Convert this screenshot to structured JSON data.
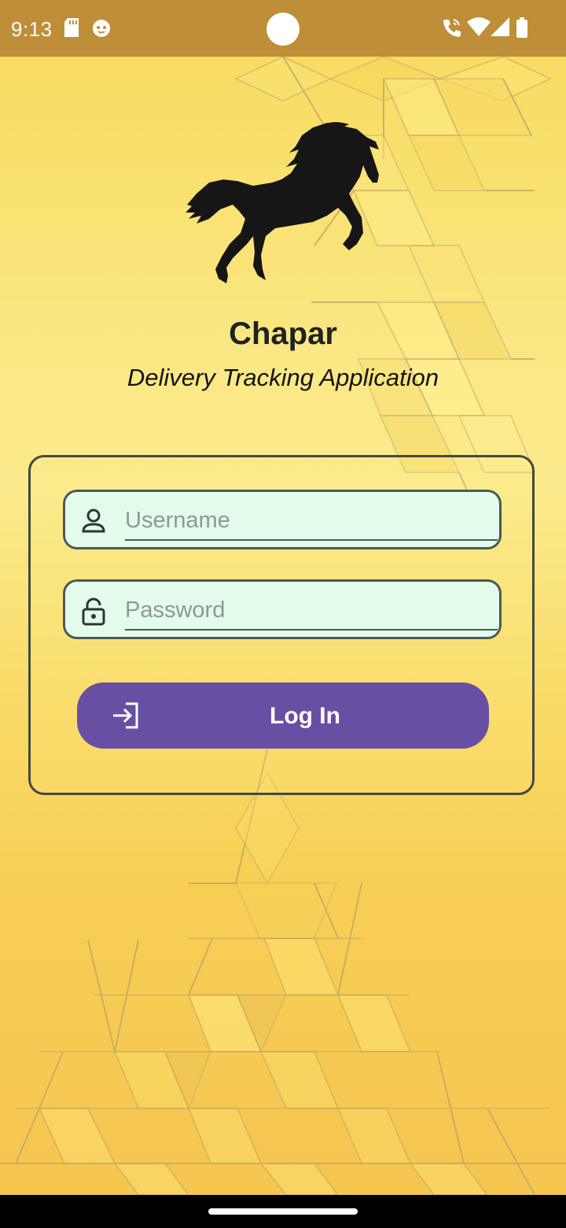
{
  "status_bar": {
    "time": "9:13",
    "left_icons": [
      "sd-card-icon",
      "cat-face-icon"
    ],
    "right_icons": [
      "wifi-calling-icon",
      "wifi-icon",
      "signal-icon",
      "battery-icon"
    ],
    "color": "#bf8e38"
  },
  "header": {
    "logo": "horse-logo-icon",
    "title": "Chapar",
    "subtitle": "Delivery Tracking Application"
  },
  "login_form": {
    "username": {
      "placeholder": "Username",
      "value": "",
      "icon": "person-icon"
    },
    "password": {
      "placeholder": "Password",
      "value": "",
      "icon": "lock-icon"
    },
    "login_button": {
      "label": "Log In",
      "icon": "login-icon"
    }
  },
  "colors": {
    "accent": "#6750a4",
    "field_background": "#e3fbeb",
    "border": "#3f4b44",
    "background_yellow": "#f8cf55"
  }
}
